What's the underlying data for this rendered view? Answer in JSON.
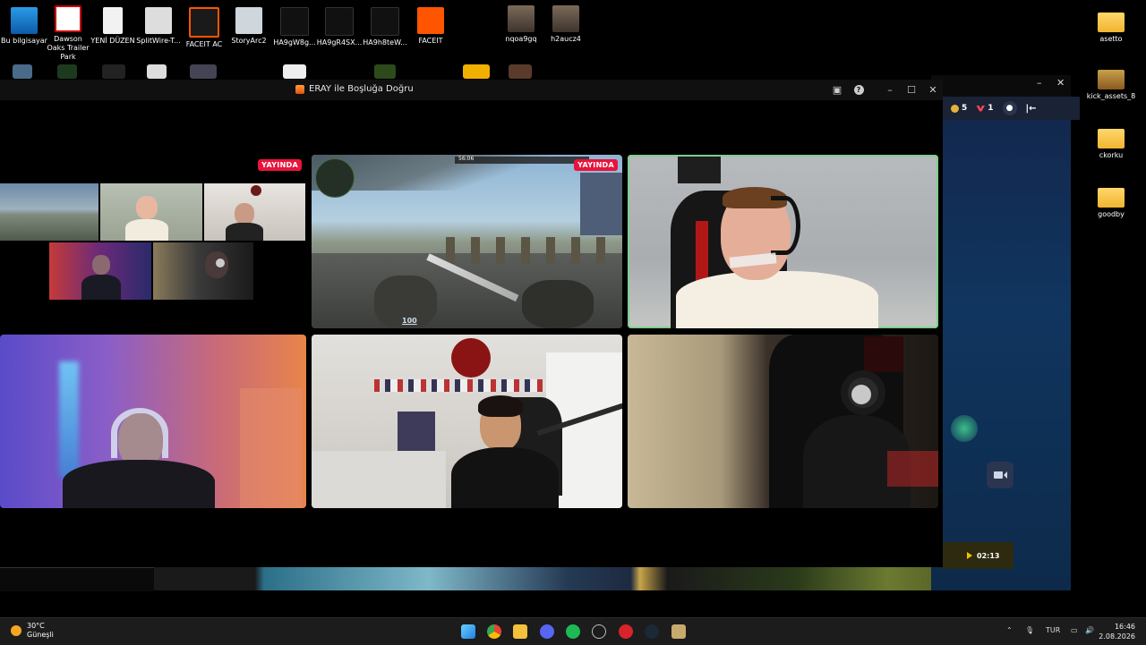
{
  "desktop_icons": [
    {
      "label": "Bu bilgisayar",
      "icon": "pc-icon"
    },
    {
      "label": "Dawson Oaks Trailer Park",
      "icon": "game-icon"
    },
    {
      "label": "YENİ DÜZEN",
      "icon": "document-icon"
    },
    {
      "label": "SplitWire-T...",
      "icon": "globe-icon"
    },
    {
      "label": "FACEIT AC",
      "icon": "faceit-ac-icon"
    },
    {
      "label": "StoryArc2",
      "icon": "image-file-icon"
    },
    {
      "label": "HA9gW8g...",
      "icon": "image-file-icon"
    },
    {
      "label": "HA9gR4SX...",
      "icon": "image-file-icon"
    },
    {
      "label": "HA9h8teW...",
      "icon": "image-file-icon"
    },
    {
      "label": "FACEIT",
      "icon": "faceit-icon"
    },
    {
      "label": "nqoa9gq",
      "icon": "photo-icon"
    },
    {
      "label": "h2aucz4",
      "icon": "photo-icon"
    }
  ],
  "right_icons": [
    {
      "label": "asetto",
      "icon": "folder-icon"
    },
    {
      "label": "kick_assets_8",
      "icon": "kick-folder-icon"
    },
    {
      "label": "ckorku",
      "icon": "folder-icon"
    },
    {
      "label": "goodby",
      "icon": "folder-icon"
    }
  ],
  "main_window": {
    "title": "ERAY ile Boşluğa Doğru",
    "live_badge": "YAYINDA",
    "hud_health": "100",
    "hud_time": "56:06"
  },
  "side_panel": {
    "coin_count": "5",
    "valorant_count": "1",
    "video_time": "02:13"
  },
  "taskbar": {
    "temperature": "30°C",
    "weather": "Güneşli",
    "language": "TUR",
    "time": "16:46",
    "date": "2.08.2026"
  },
  "colors": {
    "live_red": "#e8143c",
    "active_speaker_border": "#7ed08a",
    "faceit_orange": "#ff5500"
  }
}
